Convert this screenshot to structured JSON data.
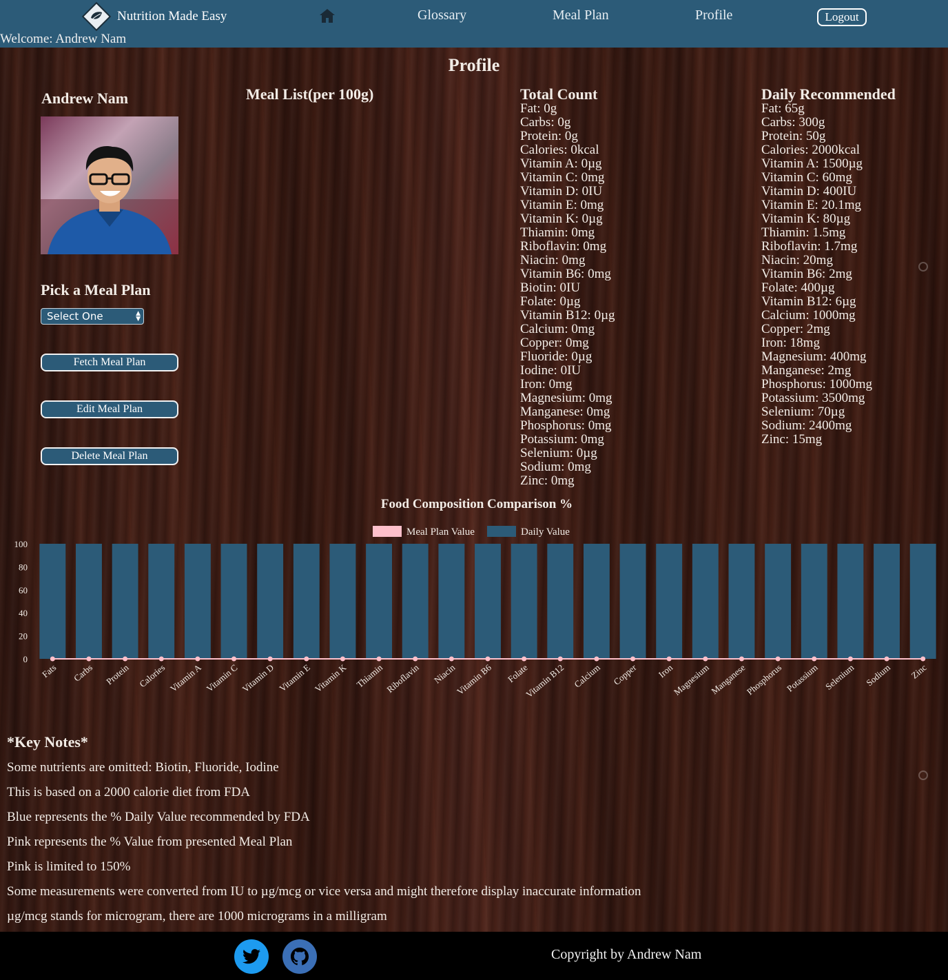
{
  "nav": {
    "brand": "Nutrition Made Easy",
    "home_icon": "home-icon",
    "links": [
      "Glossary",
      "Meal Plan",
      "Profile"
    ],
    "logout": "Logout",
    "welcome": "Welcome: Andrew Nam",
    "color": "#2c5b78"
  },
  "profile": {
    "title": "Profile",
    "name": "Andrew Nam",
    "pick_title": "Pick a Meal Plan",
    "select_value": "Select One",
    "buttons": {
      "fetch": "Fetch Meal Plan",
      "edit": "Edit Meal Plan",
      "delete": "Delete Meal Plan"
    },
    "meal_list_title": "Meal List(per 100g)"
  },
  "total_count": {
    "title": "Total Count",
    "items": [
      "Fat: 0g",
      "Carbs: 0g",
      "Protein: 0g",
      "Calories: 0kcal",
      "Vitamin A: 0µg",
      "Vitamin C: 0mg",
      "Vitamin D: 0IU",
      "Vitamin E: 0mg",
      "Vitamin K: 0µg",
      "Thiamin: 0mg",
      "Riboflavin: 0mg",
      "Niacin: 0mg",
      "Vitamin B6: 0mg",
      "Biotin: 0IU",
      "Folate: 0µg",
      "Vitamin B12: 0µg",
      "Calcium: 0mg",
      "Copper: 0mg",
      "Fluoride: 0µg",
      "Iodine: 0IU",
      "Iron: 0mg",
      "Magnesium: 0mg",
      "Manganese: 0mg",
      "Phosphorus: 0mg",
      "Potassium: 0mg",
      "Selenium: 0µg",
      "Sodium: 0mg",
      "Zinc: 0mg"
    ]
  },
  "daily_recommended": {
    "title": "Daily Recommended",
    "items": [
      "Fat: 65g",
      "Carbs: 300g",
      "Protein: 50g",
      "Calories: 2000kcal",
      "Vitamin A: 1500µg",
      "Vitamin C: 60mg",
      "Vitamin D: 400IU",
      "Vitamin E: 20.1mg",
      "Vitamin K: 80µg",
      "Thiamin: 1.5mg",
      "Riboflavin: 1.7mg",
      "Niacin: 20mg",
      "Vitamin B6: 2mg",
      "Folate: 400µg",
      "Vitamin B12: 6µg",
      "Calcium: 1000mg",
      "Copper: 2mg",
      "Iron: 18mg",
      "Magnesium: 400mg",
      "Manganese: 2mg",
      "Phosphorus: 1000mg",
      "Potassium: 3500mg",
      "Selenium: 70µg",
      "Sodium: 2400mg",
      "Zinc: 15mg"
    ]
  },
  "chart_data": {
    "type": "bar",
    "title": "Food Composition Comparison %",
    "xlabel": "",
    "ylabel": "",
    "ylim": [
      0,
      100
    ],
    "yticks": [
      0,
      20,
      40,
      60,
      80,
      100
    ],
    "legend_position": "top-center",
    "grid": false,
    "categories": [
      "Fats",
      "Carbs",
      "Protein",
      "Calories",
      "Vitamin A",
      "Vitamin C",
      "Vitamin D",
      "Vitamin E",
      "Vitamin K",
      "Thiamin",
      "Riboflavin",
      "Niacin",
      "Vitamin B6",
      "Folate",
      "Vitamin B12",
      "Calcium",
      "Copper",
      "Iron",
      "Magnesium",
      "Manganese",
      "Phosphorus",
      "Potassium",
      "Selenium",
      "Sodium",
      "Zinc"
    ],
    "series": [
      {
        "name": "Meal Plan Value",
        "color": "#ffc0cb",
        "render": "line-points",
        "values": [
          0,
          0,
          0,
          0,
          0,
          0,
          0,
          0,
          0,
          0,
          0,
          0,
          0,
          0,
          0,
          0,
          0,
          0,
          0,
          0,
          0,
          0,
          0,
          0,
          0
        ]
      },
      {
        "name": "Daily Value",
        "color": "#2c5b78",
        "render": "bar",
        "values": [
          100,
          100,
          100,
          100,
          100,
          100,
          100,
          100,
          100,
          100,
          100,
          100,
          100,
          100,
          100,
          100,
          100,
          100,
          100,
          100,
          100,
          100,
          100,
          100,
          100
        ]
      }
    ]
  },
  "key_notes": {
    "title": "*Key Notes*",
    "items": [
      "Some nutrients are omitted: Biotin, Fluoride, Iodine",
      "This is based on a 2000 calorie diet from FDA",
      "Blue represents the % Daily Value recommended by FDA",
      "Pink represents the % Value from presented Meal Plan",
      "Pink is limited to 150%",
      "Some measurements were converted from IU to µg/mcg or vice versa and might therefore display inaccurate information",
      "µg/mcg stands for microgram, there are 1000 micrograms in a milligram"
    ]
  },
  "footer": {
    "twitter_icon": "twitter-icon",
    "github_icon": "github-icon",
    "copyright": "Copyright by Andrew Nam"
  }
}
